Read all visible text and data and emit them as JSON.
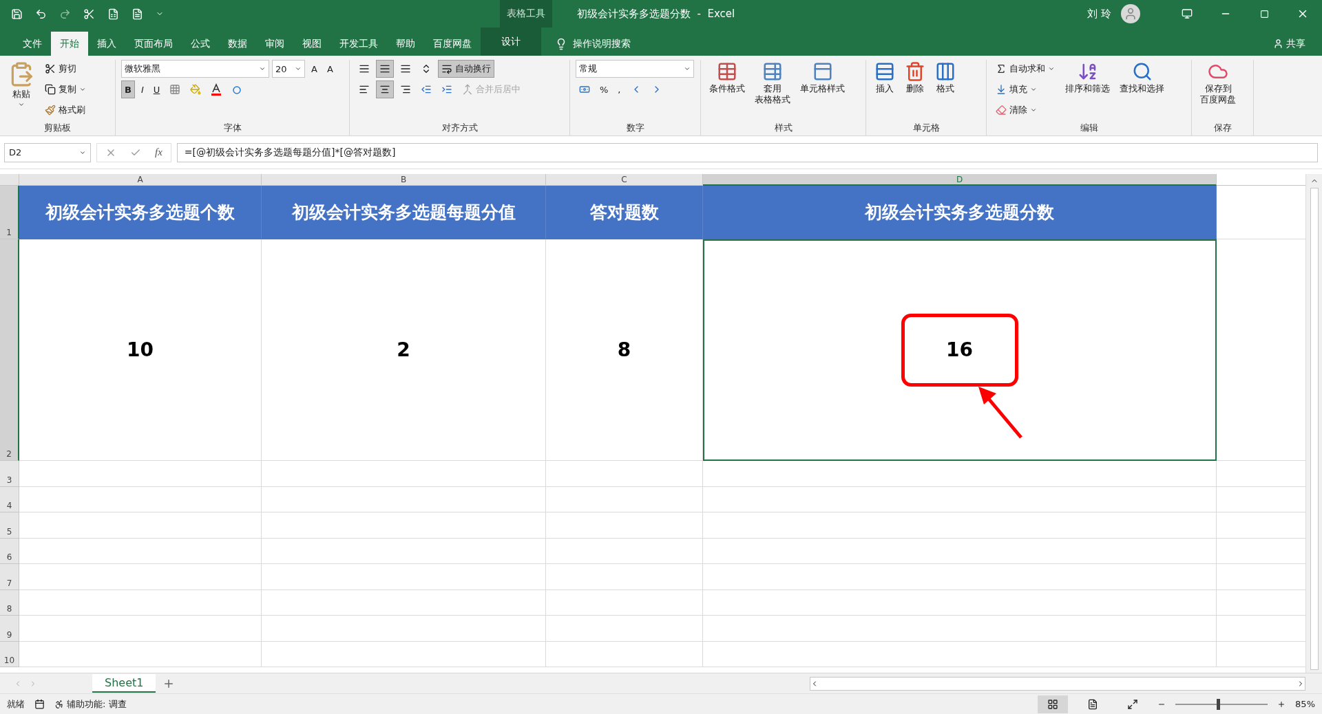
{
  "title_bar": {
    "context_label": "表格工具",
    "title": "初级会计实务多选题分数  -  Excel",
    "user": "刘 玲"
  },
  "tabs": [
    {
      "label": "文件",
      "selected": false,
      "kind": "normal"
    },
    {
      "label": "开始",
      "selected": true,
      "kind": "normal"
    },
    {
      "label": "插入",
      "selected": false,
      "kind": "normal"
    },
    {
      "label": "页面布局",
      "selected": false,
      "kind": "normal"
    },
    {
      "label": "公式",
      "selected": false,
      "kind": "normal"
    },
    {
      "label": "数据",
      "selected": false,
      "kind": "normal"
    },
    {
      "label": "审阅",
      "selected": false,
      "kind": "normal"
    },
    {
      "label": "视图",
      "selected": false,
      "kind": "normal"
    },
    {
      "label": "开发工具",
      "selected": false,
      "kind": "normal"
    },
    {
      "label": "帮助",
      "selected": false,
      "kind": "normal"
    },
    {
      "label": "百度网盘",
      "selected": false,
      "kind": "normal"
    },
    {
      "label": "设计",
      "selected": false,
      "kind": "context"
    }
  ],
  "tell_me": {
    "placeholder": "操作说明搜索"
  },
  "share": "共享",
  "ribbon": {
    "clipboard": {
      "label": "剪贴板",
      "paste": "粘贴",
      "cut": "剪切",
      "copy": "复制",
      "format_painter": "格式刷"
    },
    "font": {
      "label": "字体",
      "font_name": "微软雅黑",
      "font_size": "20",
      "grow": "A",
      "shrink": "A",
      "bold": {
        "label": "B",
        "selected": true
      },
      "italic": {
        "label": "I",
        "selected": false
      },
      "underline": {
        "label": "U",
        "selected": false
      }
    },
    "alignment": {
      "label": "对齐方式",
      "wrap_text": {
        "label": "自动换行",
        "selected": true
      },
      "merge": {
        "label": "合并后居中",
        "disabled": true
      },
      "center_selected": true,
      "middle_selected": true
    },
    "number": {
      "label": "数字",
      "format": "常规",
      "percent": "%",
      "comma": ","
    },
    "styles": {
      "label": "样式",
      "items": [
        [
          "条件格式"
        ],
        [
          "套用",
          "表格格式"
        ],
        [
          "单元格样式"
        ]
      ]
    },
    "cells": {
      "label": "单元格",
      "items": [
        "插入",
        "删除",
        "格式"
      ]
    },
    "editing": {
      "label": "编辑",
      "small": [
        "自动求和",
        "填充",
        "清除"
      ],
      "large": [
        "排序和筛选",
        "查找和选择"
      ]
    },
    "save": {
      "label": "保存",
      "item": [
        "保存到",
        "百度网盘"
      ]
    }
  },
  "formula_bar": {
    "name_box": "D2",
    "fx": "fx",
    "formula": "=[@初级会计实务多选题每题分值]*[@答对题数]"
  },
  "columns": [
    {
      "label": "A",
      "selected": false
    },
    {
      "label": "B",
      "selected": false
    },
    {
      "label": "C",
      "selected": false
    },
    {
      "label": "D",
      "selected": true
    }
  ],
  "rows": [
    {
      "number": "1",
      "cells": [
        "初级会计实务多选题个数",
        "初级会计实务多选题每题分值",
        "答对题数",
        "初级会计实务多选题分数"
      ]
    },
    {
      "number": "2",
      "cells": [
        "10",
        "2",
        "8",
        "16"
      ]
    },
    {
      "number": "3",
      "cells": []
    },
    {
      "number": "4",
      "cells": []
    },
    {
      "number": "5",
      "cells": []
    },
    {
      "number": "6",
      "cells": []
    },
    {
      "number": "7",
      "cells": []
    },
    {
      "number": "8",
      "cells": []
    },
    {
      "number": "9",
      "cells": []
    },
    {
      "number": "10",
      "cells": []
    }
  ],
  "sheet_tabs": [
    {
      "label": "Sheet1",
      "selected": true
    }
  ],
  "status_bar": {
    "ready": "就绪",
    "accessibility": "辅助功能: 调查",
    "views": [
      {
        "selected": true
      },
      {
        "selected": false
      },
      {
        "selected": false
      }
    ],
    "zoom": {
      "level": 0.45,
      "reading": "85%"
    }
  }
}
